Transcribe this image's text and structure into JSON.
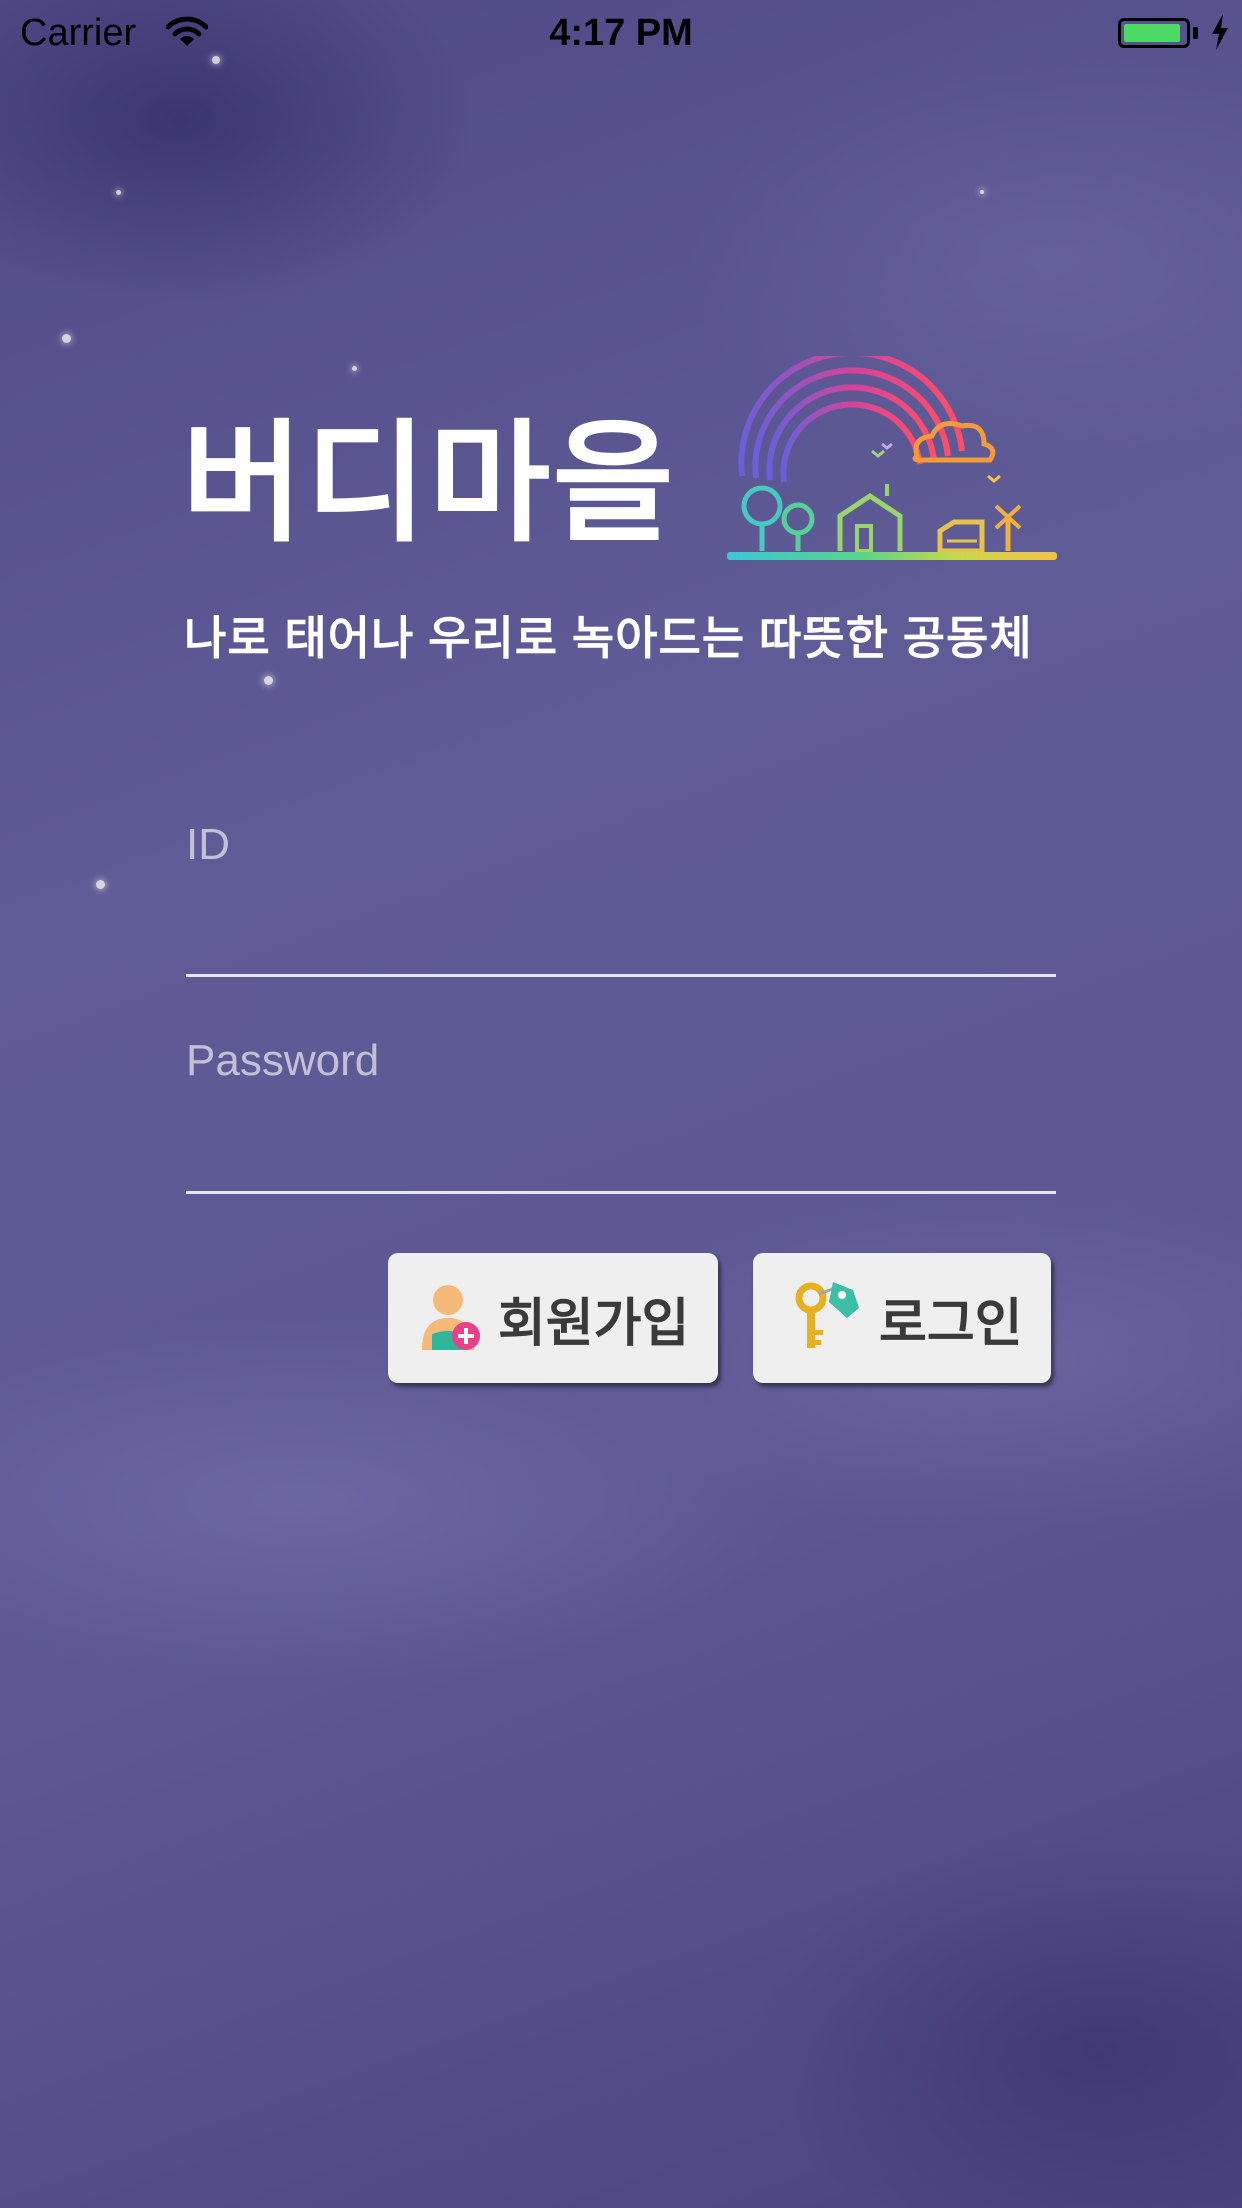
{
  "status_bar": {
    "carrier": "Carrier",
    "time": "4:17 PM",
    "battery_color": "#4cd964"
  },
  "logo": {
    "title": "버디마을",
    "tagline": "나로 태어나 우리로 녹아드는 따뜻한 공동체",
    "art_icon": "rainbow-village-illustration"
  },
  "form": {
    "id_label": "ID",
    "id_value": "",
    "password_label": "Password",
    "password_value": ""
  },
  "buttons": {
    "signup_label": "회원가입",
    "signup_icon": "user-add-icon",
    "login_label": "로그인",
    "login_icon": "key-tag-icon"
  },
  "theme": {
    "background": "#5d5894",
    "text": "#ffffff",
    "button_bg": "#efefef"
  }
}
